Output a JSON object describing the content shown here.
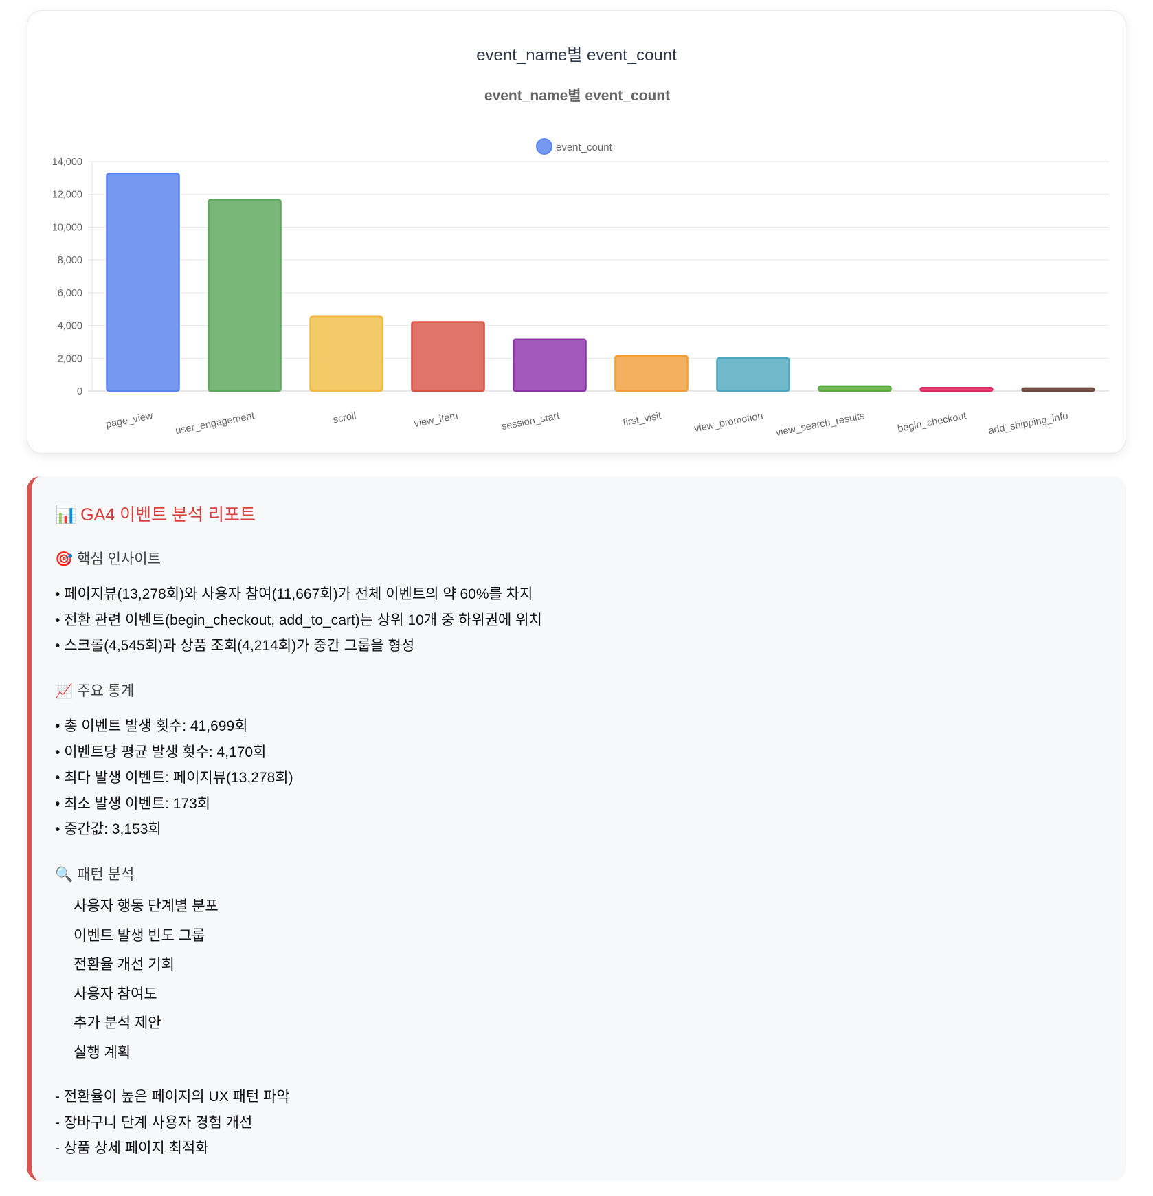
{
  "card": {
    "title": "event_name별 event_count"
  },
  "chart_data": {
    "type": "bar",
    "title": "event_name별 event_count",
    "legend": {
      "label": "event_count",
      "position": "top"
    },
    "categories": [
      "page_view",
      "user_engagement",
      "scroll",
      "view_item",
      "session_start",
      "first_visit",
      "view_promotion",
      "view_search_results",
      "begin_checkout",
      "add_shipping_info"
    ],
    "series": [
      {
        "name": "event_count",
        "values": [
          13278,
          11667,
          4545,
          4214,
          3153,
          2150,
          2000,
          300,
          200,
          173
        ]
      }
    ],
    "colors": [
      "#7599f0",
      "#79b779",
      "#f4c967",
      "#e0746a",
      "#a457bd",
      "#f3b15f",
      "#6fb9ca",
      "#73b85c",
      "#e34878",
      "#7b5b4f"
    ],
    "border_colors": [
      "#5c86ec",
      "#5fa85f",
      "#f0bc45",
      "#d95548",
      "#8e36a8",
      "#f09e3a",
      "#4ea8bd",
      "#5ca843",
      "#d92b62",
      "#6a4a3e"
    ],
    "yticks": [
      "0",
      "2,000",
      "4,000",
      "6,000",
      "8,000",
      "10,000",
      "12,000",
      "14,000"
    ],
    "ylim": [
      0,
      14000
    ],
    "xlabel": "",
    "ylabel": "",
    "grid": true
  },
  "report": {
    "title_icon": "📊",
    "title": "GA4 이벤트 분석 리포트",
    "insights": {
      "icon": "🎯",
      "heading": "핵심 인사이트",
      "items": [
        "페이지뷰(13,278회)와 사용자 참여(11,667회)가 전체 이벤트의 약 60%를 차지",
        "전환 관련 이벤트(begin_checkout, add_to_cart)는 상위 10개 중 하위권에 위치",
        "스크롤(4,545회)과 상품 조회(4,214회)가 중간 그룹을 형성"
      ]
    },
    "stats": {
      "icon": "📈",
      "heading": "주요 통계",
      "items": [
        "총 이벤트 발생 횟수: 41,699회",
        "이벤트당 평균 발생 횟수: 4,170회",
        "최다 발생 이벤트: 페이지뷰(13,278회)",
        "최소 발생 이벤트: 173회",
        "중간값: 3,153회"
      ]
    },
    "patterns": {
      "icon": "🔍",
      "heading": "패턴 분석",
      "items": [
        "사용자 행동 단계별 분포",
        "이벤트 발생 빈도 그룹",
        "전환율 개선 기회",
        "사용자 참여도",
        "추가 분석 제안",
        "실행 계획"
      ]
    },
    "actions": [
      "- 전환율이 높은 페이지의 UX 패턴 파악",
      "- 장바구니 단계 사용자 경험 개선",
      "- 상품 상세 페이지 최적화"
    ]
  }
}
